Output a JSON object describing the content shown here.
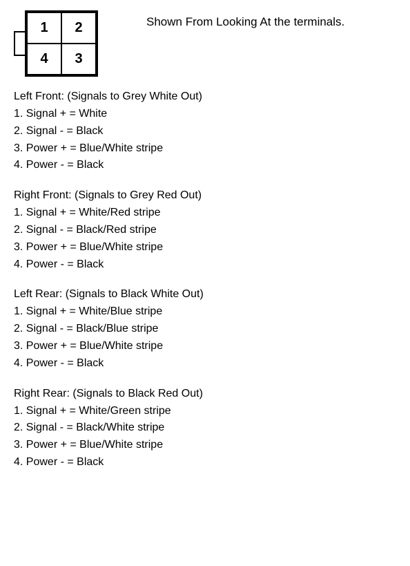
{
  "header": {
    "diagram_label": "Shown From Looking At the terminals.",
    "cells": [
      {
        "pos": "1",
        "row": 0,
        "col": 0
      },
      {
        "pos": "2",
        "row": 0,
        "col": 1
      },
      {
        "pos": "4",
        "row": 1,
        "col": 0
      },
      {
        "pos": "3",
        "row": 1,
        "col": 1
      }
    ]
  },
  "sections": [
    {
      "title": "Left Front: (Signals to Grey White Out)",
      "items": [
        "1. Signal + = White",
        "2. Signal - = Black",
        "3. Power + = Blue/White stripe",
        "4. Power - = Black"
      ]
    },
    {
      "title": "Right Front: (Signals to Grey Red Out)",
      "items": [
        "1. Signal + = White/Red stripe",
        "2. Signal - = Black/Red stripe",
        "3. Power + = Blue/White stripe",
        "4. Power - = Black"
      ]
    },
    {
      "title": "Left Rear: (Signals to Black White Out)",
      "items": [
        "1. Signal + = White/Blue stripe",
        "2. Signal - = Black/Blue stripe",
        "3. Power + = Blue/White stripe",
        "4. Power - = Black"
      ]
    },
    {
      "title": "Right Rear: (Signals to Black Red Out)",
      "items": [
        "1. Signal + = White/Green stripe",
        "2. Signal - = Black/White stripe",
        "3. Power + = Blue/White stripe",
        "4. Power - = Black"
      ]
    }
  ]
}
